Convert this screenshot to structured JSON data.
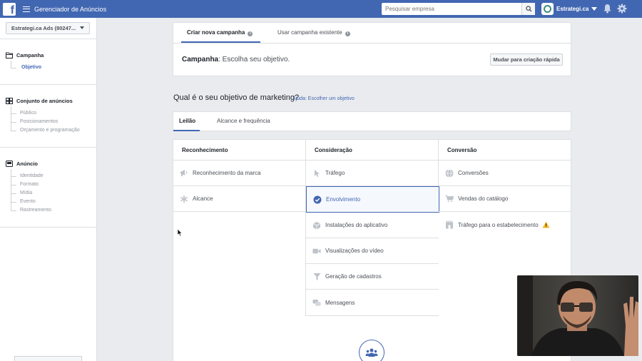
{
  "topbar": {
    "app_title": "Gerenciador de Anúncios",
    "search_placeholder": "Pesquisar empresa",
    "account_name": "Estrategi.ca",
    "colors": {
      "bar": "#4267b2"
    }
  },
  "sidebar": {
    "ad_account": "Estrategi.ca Ads (80247...",
    "campaign": {
      "label": "Campanha",
      "sub": "Objetivo"
    },
    "adset": {
      "label": "Conjunto de anúncios",
      "items": [
        "Público",
        "Posicionamentos",
        "Orçamento e programação"
      ]
    },
    "ad": {
      "label": "Anúncio",
      "items": [
        "Identidade",
        "Formato",
        "Mídia",
        "Evento",
        "Rastreamento"
      ]
    }
  },
  "campaign_card": {
    "tabs": [
      {
        "label": "Criar nova campanha",
        "active": true
      },
      {
        "label": "Usar campanha existente",
        "active": false
      }
    ],
    "heading_bold": "Campanha",
    "heading_rest": ": Escolha seu objetivo.",
    "quick_button": "Mudar para criação rápida"
  },
  "objective": {
    "question": "Qual é o seu objetivo de marketing?",
    "help": "Ajuda: Escolher um objetivo",
    "buy_tabs": [
      {
        "label": "Leilão",
        "active": true
      },
      {
        "label": "Alcance e frequência",
        "active": false
      }
    ],
    "columns": [
      {
        "title": "Reconhecimento",
        "items": [
          {
            "label": "Reconhecimento da marca",
            "icon": "megaphone-icon"
          },
          {
            "label": "Alcance",
            "icon": "asterisk-icon"
          }
        ]
      },
      {
        "title": "Consideração",
        "items": [
          {
            "label": "Tráfego",
            "icon": "cursor-icon"
          },
          {
            "label": "Envolvimento",
            "icon": "check-circle-icon",
            "selected": true
          },
          {
            "label": "Instalações do aplicativo",
            "icon": "box-icon"
          },
          {
            "label": "Visualizações do vídeo",
            "icon": "video-camera-icon"
          },
          {
            "label": "Geração de cadastros",
            "icon": "funnel-icon"
          },
          {
            "label": "Mensagens",
            "icon": "chat-bubbles-icon"
          }
        ]
      },
      {
        "title": "Conversão",
        "items": [
          {
            "label": "Conversões",
            "icon": "globe-icon"
          },
          {
            "label": "Vendas do catálogo",
            "icon": "shopping-cart-icon"
          },
          {
            "label": "Tráfego para o estabelecimento",
            "icon": "store-icon",
            "warning": true
          }
        ]
      }
    ],
    "colors": {
      "accent": "#4267b2",
      "warning": "#f7b928"
    }
  }
}
